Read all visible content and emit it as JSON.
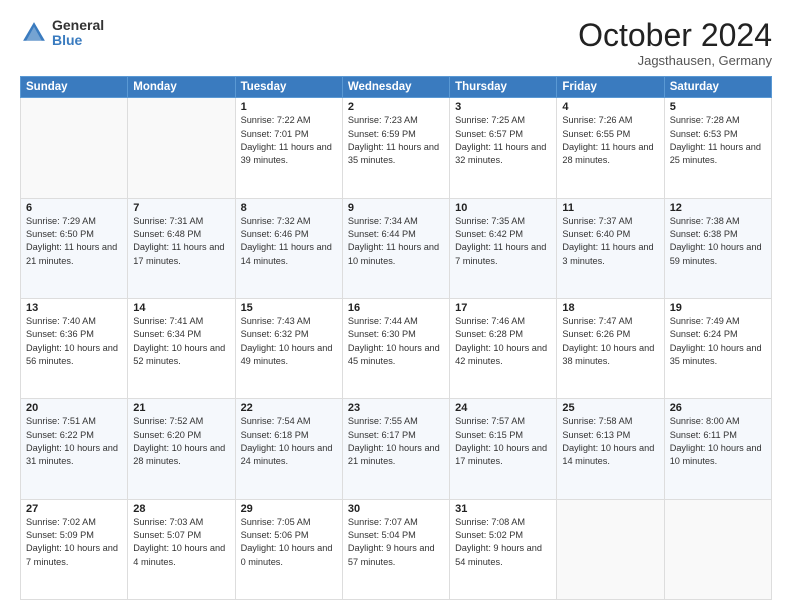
{
  "header": {
    "logo_general": "General",
    "logo_blue": "Blue",
    "month": "October 2024",
    "location": "Jagsthausen, Germany"
  },
  "weekdays": [
    "Sunday",
    "Monday",
    "Tuesday",
    "Wednesday",
    "Thursday",
    "Friday",
    "Saturday"
  ],
  "weeks": [
    [
      {
        "day": "",
        "info": ""
      },
      {
        "day": "",
        "info": ""
      },
      {
        "day": "1",
        "info": "Sunrise: 7:22 AM\nSunset: 7:01 PM\nDaylight: 11 hours and 39 minutes."
      },
      {
        "day": "2",
        "info": "Sunrise: 7:23 AM\nSunset: 6:59 PM\nDaylight: 11 hours and 35 minutes."
      },
      {
        "day": "3",
        "info": "Sunrise: 7:25 AM\nSunset: 6:57 PM\nDaylight: 11 hours and 32 minutes."
      },
      {
        "day": "4",
        "info": "Sunrise: 7:26 AM\nSunset: 6:55 PM\nDaylight: 11 hours and 28 minutes."
      },
      {
        "day": "5",
        "info": "Sunrise: 7:28 AM\nSunset: 6:53 PM\nDaylight: 11 hours and 25 minutes."
      }
    ],
    [
      {
        "day": "6",
        "info": "Sunrise: 7:29 AM\nSunset: 6:50 PM\nDaylight: 11 hours and 21 minutes."
      },
      {
        "day": "7",
        "info": "Sunrise: 7:31 AM\nSunset: 6:48 PM\nDaylight: 11 hours and 17 minutes."
      },
      {
        "day": "8",
        "info": "Sunrise: 7:32 AM\nSunset: 6:46 PM\nDaylight: 11 hours and 14 minutes."
      },
      {
        "day": "9",
        "info": "Sunrise: 7:34 AM\nSunset: 6:44 PM\nDaylight: 11 hours and 10 minutes."
      },
      {
        "day": "10",
        "info": "Sunrise: 7:35 AM\nSunset: 6:42 PM\nDaylight: 11 hours and 7 minutes."
      },
      {
        "day": "11",
        "info": "Sunrise: 7:37 AM\nSunset: 6:40 PM\nDaylight: 11 hours and 3 minutes."
      },
      {
        "day": "12",
        "info": "Sunrise: 7:38 AM\nSunset: 6:38 PM\nDaylight: 10 hours and 59 minutes."
      }
    ],
    [
      {
        "day": "13",
        "info": "Sunrise: 7:40 AM\nSunset: 6:36 PM\nDaylight: 10 hours and 56 minutes."
      },
      {
        "day": "14",
        "info": "Sunrise: 7:41 AM\nSunset: 6:34 PM\nDaylight: 10 hours and 52 minutes."
      },
      {
        "day": "15",
        "info": "Sunrise: 7:43 AM\nSunset: 6:32 PM\nDaylight: 10 hours and 49 minutes."
      },
      {
        "day": "16",
        "info": "Sunrise: 7:44 AM\nSunset: 6:30 PM\nDaylight: 10 hours and 45 minutes."
      },
      {
        "day": "17",
        "info": "Sunrise: 7:46 AM\nSunset: 6:28 PM\nDaylight: 10 hours and 42 minutes."
      },
      {
        "day": "18",
        "info": "Sunrise: 7:47 AM\nSunset: 6:26 PM\nDaylight: 10 hours and 38 minutes."
      },
      {
        "day": "19",
        "info": "Sunrise: 7:49 AM\nSunset: 6:24 PM\nDaylight: 10 hours and 35 minutes."
      }
    ],
    [
      {
        "day": "20",
        "info": "Sunrise: 7:51 AM\nSunset: 6:22 PM\nDaylight: 10 hours and 31 minutes."
      },
      {
        "day": "21",
        "info": "Sunrise: 7:52 AM\nSunset: 6:20 PM\nDaylight: 10 hours and 28 minutes."
      },
      {
        "day": "22",
        "info": "Sunrise: 7:54 AM\nSunset: 6:18 PM\nDaylight: 10 hours and 24 minutes."
      },
      {
        "day": "23",
        "info": "Sunrise: 7:55 AM\nSunset: 6:17 PM\nDaylight: 10 hours and 21 minutes."
      },
      {
        "day": "24",
        "info": "Sunrise: 7:57 AM\nSunset: 6:15 PM\nDaylight: 10 hours and 17 minutes."
      },
      {
        "day": "25",
        "info": "Sunrise: 7:58 AM\nSunset: 6:13 PM\nDaylight: 10 hours and 14 minutes."
      },
      {
        "day": "26",
        "info": "Sunrise: 8:00 AM\nSunset: 6:11 PM\nDaylight: 10 hours and 10 minutes."
      }
    ],
    [
      {
        "day": "27",
        "info": "Sunrise: 7:02 AM\nSunset: 5:09 PM\nDaylight: 10 hours and 7 minutes."
      },
      {
        "day": "28",
        "info": "Sunrise: 7:03 AM\nSunset: 5:07 PM\nDaylight: 10 hours and 4 minutes."
      },
      {
        "day": "29",
        "info": "Sunrise: 7:05 AM\nSunset: 5:06 PM\nDaylight: 10 hours and 0 minutes."
      },
      {
        "day": "30",
        "info": "Sunrise: 7:07 AM\nSunset: 5:04 PM\nDaylight: 9 hours and 57 minutes."
      },
      {
        "day": "31",
        "info": "Sunrise: 7:08 AM\nSunset: 5:02 PM\nDaylight: 9 hours and 54 minutes."
      },
      {
        "day": "",
        "info": ""
      },
      {
        "day": "",
        "info": ""
      }
    ]
  ]
}
